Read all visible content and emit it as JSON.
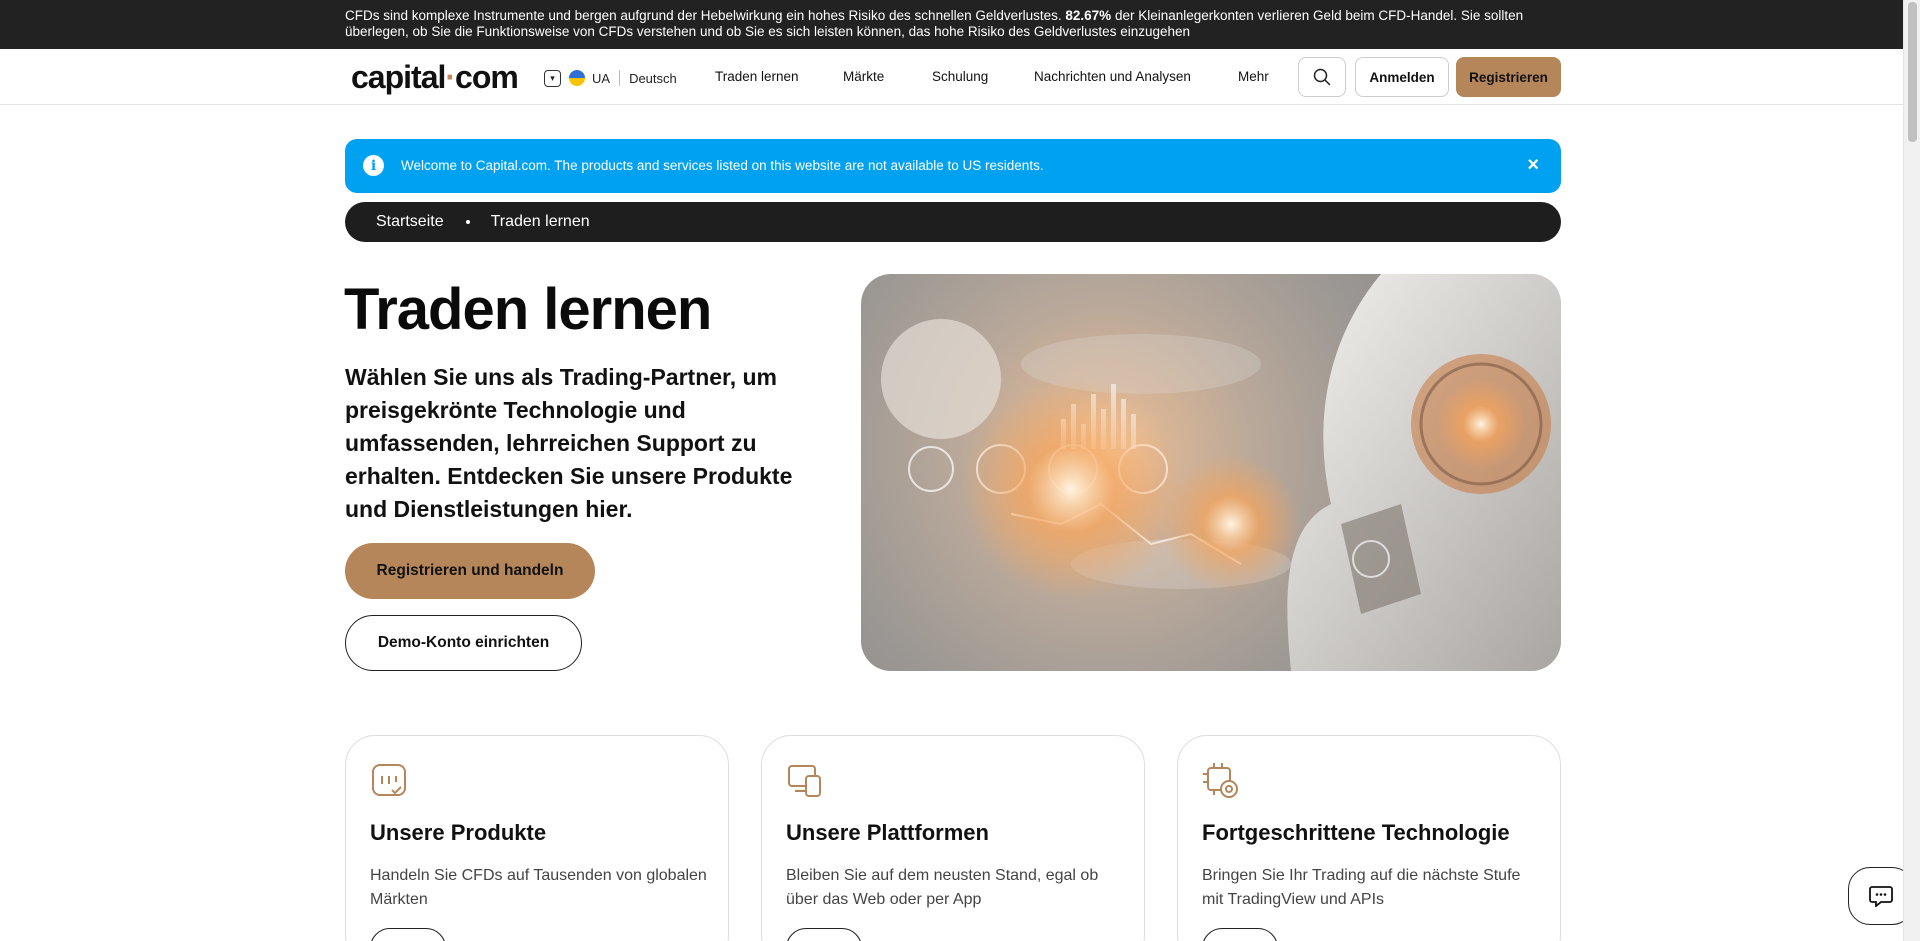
{
  "risk_warning": {
    "before": "CFDs sind komplexe Instrumente und bergen aufgrund der Hebelwirkung ein hohes Risiko des schnellen Geldverlustes. ",
    "percent": "82.67%",
    "after": " der Kleinanlegerkonten verlieren Geld beim CFD-Handel. Sie sollten überlegen, ob Sie die Funktionsweise von CFDs verstehen und ob Sie es sich leisten können, das hohe Risiko des Geldverlustes einzugehen"
  },
  "header": {
    "logo_left": "capital",
    "logo_dot": "·",
    "logo_right": "com",
    "region": "UA",
    "language": "Deutsch",
    "nav": [
      "Traden lernen",
      "Märkte",
      "Schulung",
      "Nachrichten und Analysen",
      "Mehr"
    ],
    "login_label": "Anmelden",
    "register_label": "Registrieren"
  },
  "alert": {
    "message": "Welcome to Capital.com. The products and services listed on this website are not available to US residents.",
    "close": "×"
  },
  "breadcrumb": [
    "Startseite",
    "Traden lernen"
  ],
  "hero": {
    "title": "Traden lernen",
    "subtitle": "Wählen Sie uns als Trading-Partner, um preisgekrönte Technologie und umfassenden, lehrreichen Support zu erhalten. Entdecken Sie unsere Produkte und Dienstleistungen hier.",
    "primary_cta": "Registrieren und handeln",
    "secondary_cta": "Demo-Konto einrichten"
  },
  "cards": [
    {
      "icon": "products-icon",
      "title": "Unsere Produkte",
      "description": "Handeln Sie CFDs auf Tausenden von globalen Märkten"
    },
    {
      "icon": "devices-icon",
      "title": "Unsere Plattformen",
      "description": "Bleiben Sie auf dem neusten Stand, egal ob über das Web oder per App"
    },
    {
      "icon": "chip-gear-icon",
      "title": "Fortgeschrittene Technologie",
      "description": "Bringen Sie Ihr Trading auf die nächste Stufe mit TradingView und APIs"
    }
  ],
  "colors": {
    "accent": "#b5865a",
    "alert_bg": "#00a1f1",
    "dark_bar": "#1e1e1e"
  }
}
